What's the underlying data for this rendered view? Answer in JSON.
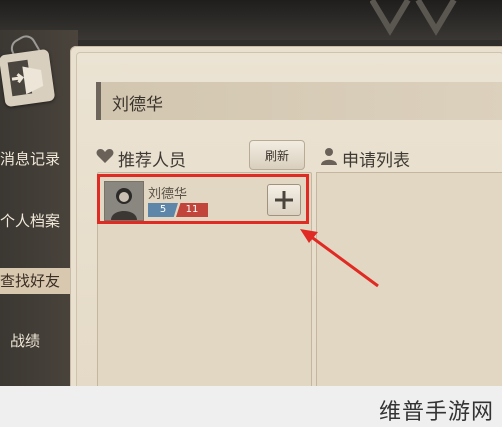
{
  "sidebar": {
    "items": [
      {
        "label": "消息记录"
      },
      {
        "label": "个人档案"
      },
      {
        "label": "查找好友"
      },
      {
        "label": "战绩"
      }
    ]
  },
  "search": {
    "value": "刘德华"
  },
  "recommend": {
    "title": "推荐人员",
    "refresh_label": "刷新",
    "user": {
      "name": "刘德华",
      "badge_left": "5",
      "badge_right": "11"
    }
  },
  "apply": {
    "title": "申请列表"
  },
  "watermark": "维普手游网",
  "colors": {
    "highlight": "#e02a24",
    "panel": "#e9e0cf"
  }
}
